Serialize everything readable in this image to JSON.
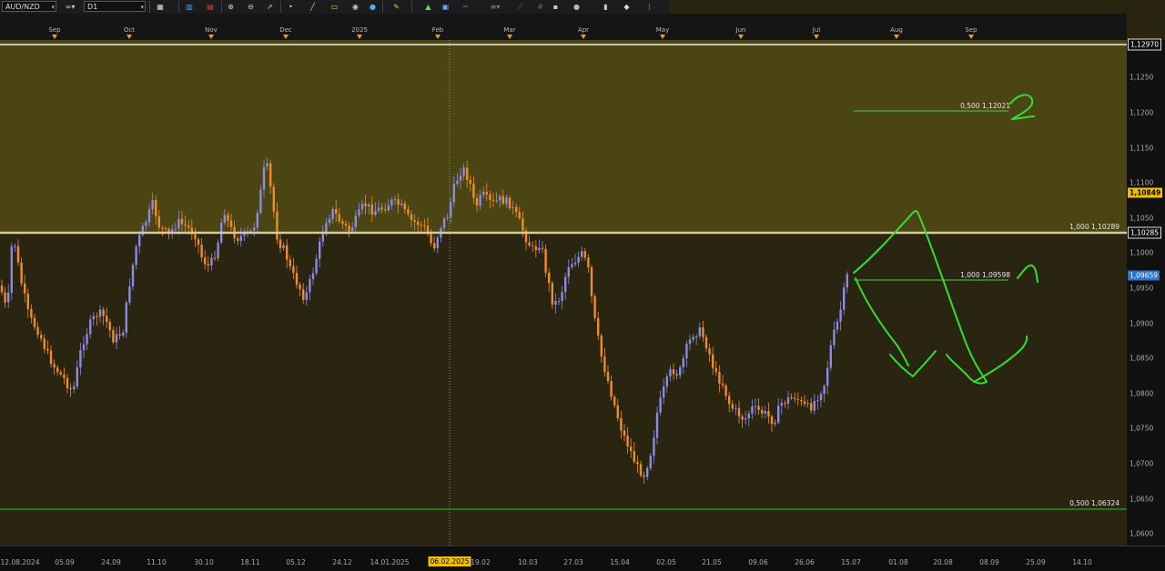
{
  "toolbar": {
    "symbol": "AUD/NZD",
    "timeframe": "D1",
    "icons": [
      "chain-link-icon",
      "bar-chart-icon",
      "candles-icon",
      "zoom-in-icon",
      "zoom-out-icon",
      "crosshair-icon",
      "line-icon",
      "plus-icon",
      "arrow-icon",
      "pencil-icon",
      "hand-icon",
      "eye-icon",
      "refresh-icon",
      "grid-icon",
      "template-icon",
      "fibonacci-icon",
      "eraser-icon",
      "lock-icon",
      "settings-icon",
      "indicators-icon",
      "marker-icon",
      "trash-icon",
      "circle-icon",
      "list-icon",
      "reset-icon",
      "menu-icon"
    ]
  },
  "months": [
    "Sep",
    "Oct",
    "Nov",
    "Dec",
    "2025",
    "Feb",
    "Mar",
    "Apr",
    "May",
    "Jun",
    "Jul",
    "Aug",
    "Sep"
  ],
  "price_axis": {
    "labels": [
      "1,1250",
      "1,1200",
      "1,1150",
      "1,1100",
      "1,1050",
      "1,1000",
      "1,0950",
      "1,0900",
      "1,0850",
      "1,0800",
      "1,0750",
      "1,0700",
      "1,0650",
      "1,0600"
    ],
    "top_tag": "1,12970",
    "current_tag": "1,10849",
    "level_tag": "1,10285",
    "blue_tag": "1,09659"
  },
  "date_axis": {
    "labels": [
      "12.08.2024",
      "05.09",
      "24.09",
      "11.10",
      "30.10",
      "18.11",
      "05.12",
      "24.12",
      "14.01.2025",
      "19.02",
      "10.03",
      "27.03",
      "15.04",
      "02.05",
      "21.05",
      "09.06",
      "26.06",
      "15.07",
      "01.08",
      "20.08",
      "08.09",
      "25.09",
      "14.10"
    ],
    "highlight": "06.02.2025"
  },
  "levels": {
    "top": "1,12970",
    "upper_fib": "1,000 1,10289",
    "lower_fib": "0,500 1,06324",
    "target_upper": "0,500 1,12021",
    "target_mid": "1,000 1,09598"
  },
  "colors": {
    "upper_zone": "#4a4512",
    "lower_zone": "#2a2510",
    "bull_candle": "#8a8ae8",
    "bear_candle": "#f08c28",
    "drawing": "#33dd33",
    "level_line": "#d8c8a0"
  }
}
